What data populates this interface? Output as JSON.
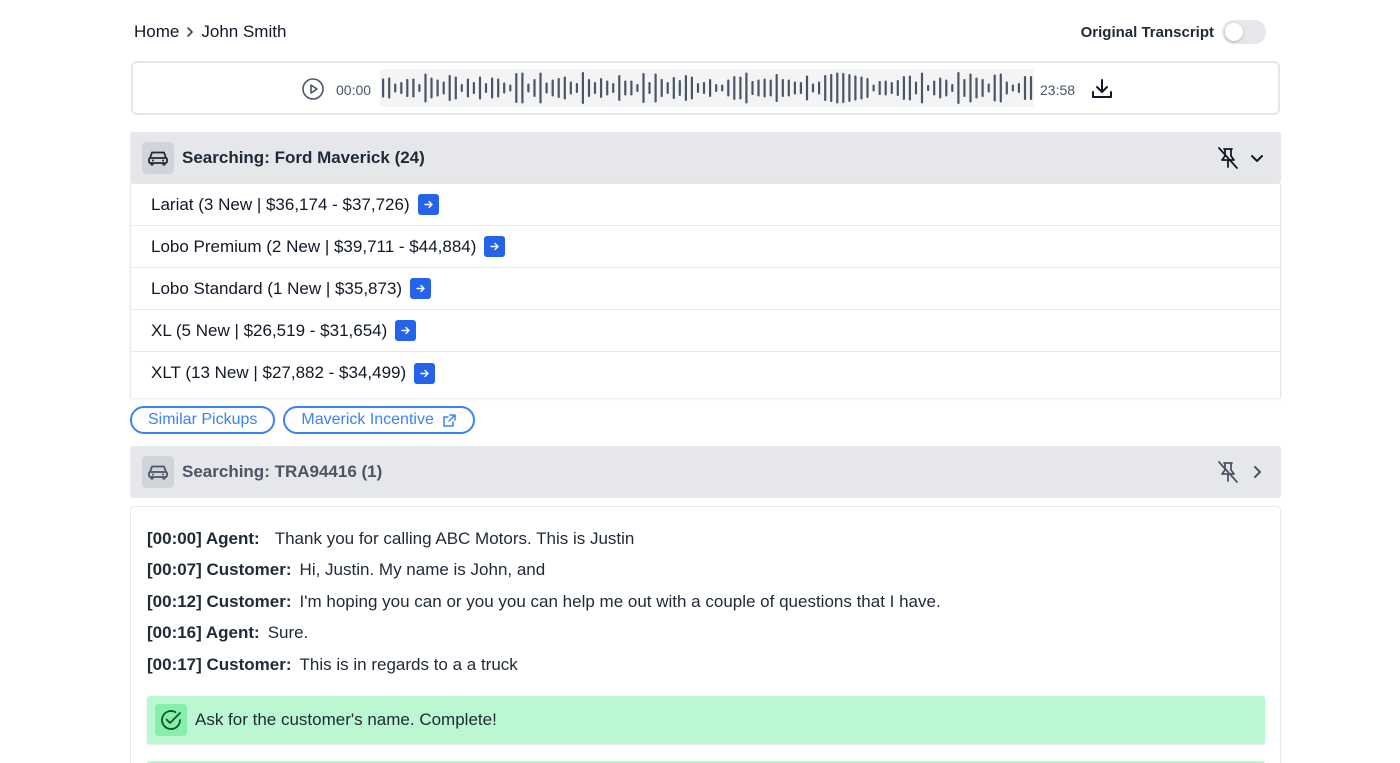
{
  "breadcrumb": {
    "home": "Home",
    "current": "John Smith"
  },
  "toggle": {
    "label": "Original Transcript",
    "on": false
  },
  "player": {
    "time_start": "00:00",
    "time_end": "23:58"
  },
  "search_panels": [
    {
      "title": "Searching: Ford Maverick (24)",
      "expanded": true,
      "results": [
        "Lariat (3 New | $36,174 - $37,726)",
        "Lobo Premium (2 New | $39,711 - $44,884)",
        "Lobo Standard (1 New | $35,873)",
        "XL (5 New | $26,519 - $31,654)",
        "XLT (13 New | $27,882 - $34,499)"
      ]
    },
    {
      "title": "Searching: TRA94416 (1)",
      "expanded": false,
      "results": []
    }
  ],
  "chips": [
    {
      "label": "Similar Pickups",
      "external": false
    },
    {
      "label": "Maverick Incentive",
      "external": true
    }
  ],
  "transcript": [
    {
      "speaker": "[00:00] Agent:",
      "text": "Thank you for calling ABC Motors. This is Justin"
    },
    {
      "speaker": "[00:07] Customer:",
      "text": "Hi, Justin. My name is John, and"
    },
    {
      "speaker": "[00:12] Customer:",
      "text": "I'm hoping you can or you you can help me out with a couple of questions that I have."
    },
    {
      "speaker": "[00:16] Agent:",
      "text": "Sure."
    },
    {
      "speaker": "[00:17] Customer:",
      "text": "This is in regards to a a truck"
    }
  ],
  "task": {
    "text": "Ask for the customer's name. Complete!"
  },
  "colors": {
    "accent": "#2563eb",
    "chip_border": "#3b82f6",
    "task_bg": "#bbf7d0",
    "header_bg": "#e5e7eb"
  },
  "icons": {
    "play": "play-circle-icon",
    "download": "download-icon",
    "car": "car-icon",
    "pin_off": "pin-off-icon",
    "chevron_down": "chevron-down-icon",
    "chevron_right": "chevron-right-icon",
    "arrow_right": "arrow-right-icon",
    "external_link": "external-link-icon",
    "check_circle": "check-circle-icon"
  }
}
